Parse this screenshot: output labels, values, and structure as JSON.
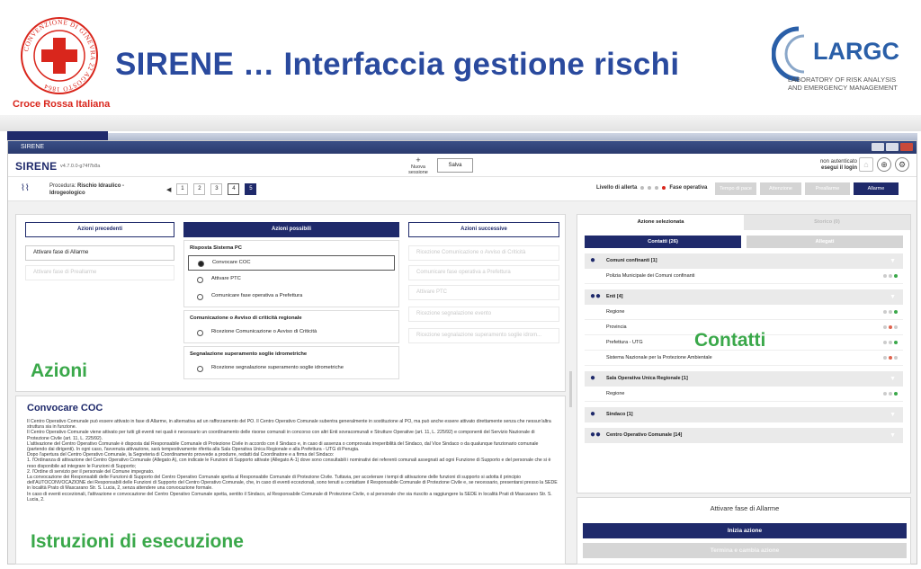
{
  "slide": {
    "title": "SIRENE … Interfaccia gestione rischi",
    "cri_text": "Croce Rossa Italiana",
    "cri_ring_text": "CONVENZIONE DI GINEVRA 22 AGOSTO 1864",
    "larc_name": "LARGC",
    "larc_sub1": "LABORATORY OF RISK ANALYSIS",
    "larc_sub2": "AND EMERGENCY MANAGEMENT"
  },
  "window": {
    "title": "SIRENE",
    "brand": "SIRENE",
    "version": "v4.7.0.0-g74f7b8a",
    "new_session": "Nuova sessione",
    "save_label": "Salva",
    "login_status": "non autenticato",
    "login_link": "esegui il login"
  },
  "procedure": {
    "label": "Procedura:",
    "name": "Rischio Idraulico - Idrogeologico",
    "pages": [
      "1",
      "2",
      "3",
      "4",
      "5"
    ],
    "alert_label": "Livello di allerta",
    "operative_phase": "Fase operativa",
    "phases": [
      "Tempo di pace",
      "Attenzione",
      "Preallarme",
      "Allarme"
    ]
  },
  "actions": {
    "previous_header": "Azioni precedenti",
    "possible_header": "Azioni possibili",
    "next_header": "Azioni successive",
    "previous_items": [
      "Attivare fase di Allarme",
      "Attivare fase di Preallarme"
    ],
    "groups": [
      {
        "title": "Risposta Sistema PC",
        "options": [
          "Convocare COC",
          "Attivare PTC",
          "Comunicare fase operativa a Prefettura"
        ]
      },
      {
        "title": "Comunicazione o Avviso di criticità regionale",
        "options": [
          "Ricezione Comunicazione o Avviso di Criticità"
        ]
      },
      {
        "title": "Segnalazione superamento soglie idrometriche",
        "options": [
          "Ricezione segnalazione superamento soglie idrometriche"
        ]
      }
    ],
    "next_items": [
      "Ricezione Comunicazione o Avviso di Criticità",
      "Comunicare fase operativa a Prefettura",
      "Attivare PTC",
      "Ricezione segnalazione evento",
      "Ricezione segnalazione superamento soglie idrom..."
    ],
    "overlay_label": "Azioni"
  },
  "instructions": {
    "title": "Convocare COC",
    "paragraphs": [
      "Il Centro Operativo Comunale può essere attivato in fase di Allarme, in alternativa ad un rafforzamento del PO. Il Centro Operativo Comunale subentra generalmente in sostituzione al PO, ma può anche essere attivato direttamente senza che nessun'altra struttura sia in funzione.",
      "Il Centro Operativo Comunale viene attivato per tutti gli eventi nei quali è necessario un coordinamento delle risorse comunali in concorso con altri Enti sovracomunali e Strutture Operative (art. 11, L. 225/92) e componenti del Servizio Nazionale di Protezione Civile (art. 11, L. 225/92).",
      "L'attivazione del Centro Operativo Comunale è disposta dal Responsabile Comunale di Protezione Civile in accordo con il Sindaco e, in caso di assenza o comprovata irreperibilità del Sindaco, dal Vice Sindaco o da qualunque funzionario comunale (partendo dai dirigenti). In ogni caso, l'avvenuta attivazione, sarà tempestivamente riferita alla Sala Operativa Unica Regionale e alla Prefettura - UTG di Perugia.",
      "Dopo l'apertura del Centro Operativo Comunale, la Segreteria di Coordinamento provvede a produrre, redatti dal Coordinatore e a firma del Sindaco:",
      "1. l'Ordinanza di attivazione del Centro Operativo Comunale (Allegato A), con indicate le Funzioni di Supporto attivate (Allegato A-1) dove sono consultabili i nominativi dei referenti comunali assegnati ad ogni Funzione di Supporto e del personale che si è reso disponibile ad integrare le Funzioni di Supporto;",
      "2. l'Ordine di servizio per il personale del Comune impegnato.",
      "La convocazione dei Responsabili delle Funzioni di Supporto del Centro Operativo Comunale spetta al Responsabile Comunale di Protezione Civile. Tuttavia, per accelerare i tempi di attivazione delle funzioni di supporto si adotta il principio dell'AUTOCONVOCAZIONE dei Responsabili delle Funzioni di Supporto del Centro Operativo Comunale, che, in caso di eventi eccezionali, sono tenuti a contattare il Responsabile Comunale di Protezione Civile e, se necessario, presentarsi presso la SEDE in località Prato di Mascarano Str. S. Lucia, 2, senza attendere una convocazione formale.",
      "In caso di eventi eccezionali, l'attivazione e convocazione del Centro Operativo Comunale spetta, sentito il Sindaco, al Responsabile Comunale di Protezione Civile, o al personale che sia riuscito a raggiungere la SEDE in località Prati di Mascarano Str. S. Lucia, 2."
    ],
    "overlay_label": "Istruzioni di esecuzione"
  },
  "contacts": {
    "tab_selected": "Azione selezionata",
    "tab_other": "Storico (0)",
    "sub_contacts": "Contatti (26)",
    "sub_attachments": "Allegati",
    "groups": [
      {
        "name": "Comuni confinanti [1]",
        "icon": "person-icon",
        "items": [
          "Polizia Municipale dei Comuni confinanti"
        ]
      },
      {
        "name": "Enti [4]",
        "icon": "group-icon",
        "items": [
          "Regione",
          "Provincia",
          "Prefettura - UTG",
          "Sistema Nazionale per la Protezione Ambientale"
        ]
      },
      {
        "name": "Sala Operativa Unica Regionale [1]",
        "icon": "person-icon",
        "items": [
          "Regione"
        ]
      },
      {
        "name": "Sindaco [1]",
        "icon": "person-icon",
        "items": []
      },
      {
        "name": "Centro Operativo Comunale [14]",
        "icon": "group-icon",
        "items": []
      }
    ],
    "overlay_label": "Contatti"
  },
  "action_panel": {
    "title": "Attivare fase di Allarme",
    "start_label": "Inizia azione",
    "finish_label": "Termina e cambia azione"
  },
  "colors": {
    "navy": "#1f2a6b",
    "green_label": "#3aa84a",
    "cri_red": "#d9261c",
    "title_blue": "#2a4a9e"
  }
}
